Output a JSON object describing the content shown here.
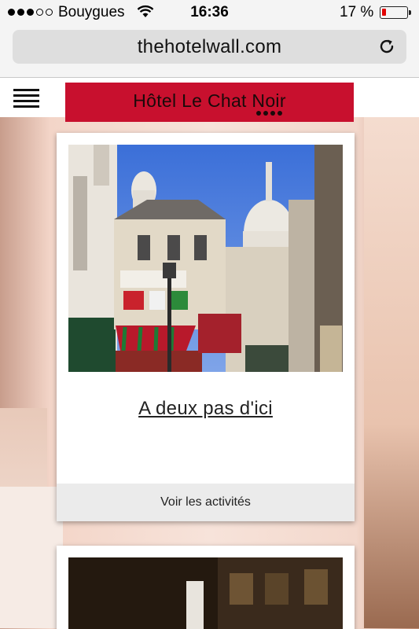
{
  "status_bar": {
    "carrier": "Bouygues",
    "time": "16:36",
    "battery_percent": "17 %"
  },
  "browser": {
    "url": "thehotelwall.com"
  },
  "header": {
    "logo_text": "Hôtel Le Chat Noir"
  },
  "cards": [
    {
      "title": "A deux pas d'ici",
      "footer_link": "Voir les activités"
    }
  ],
  "colors": {
    "brand_red": "#c8102e",
    "battery_low": "#e10000"
  }
}
